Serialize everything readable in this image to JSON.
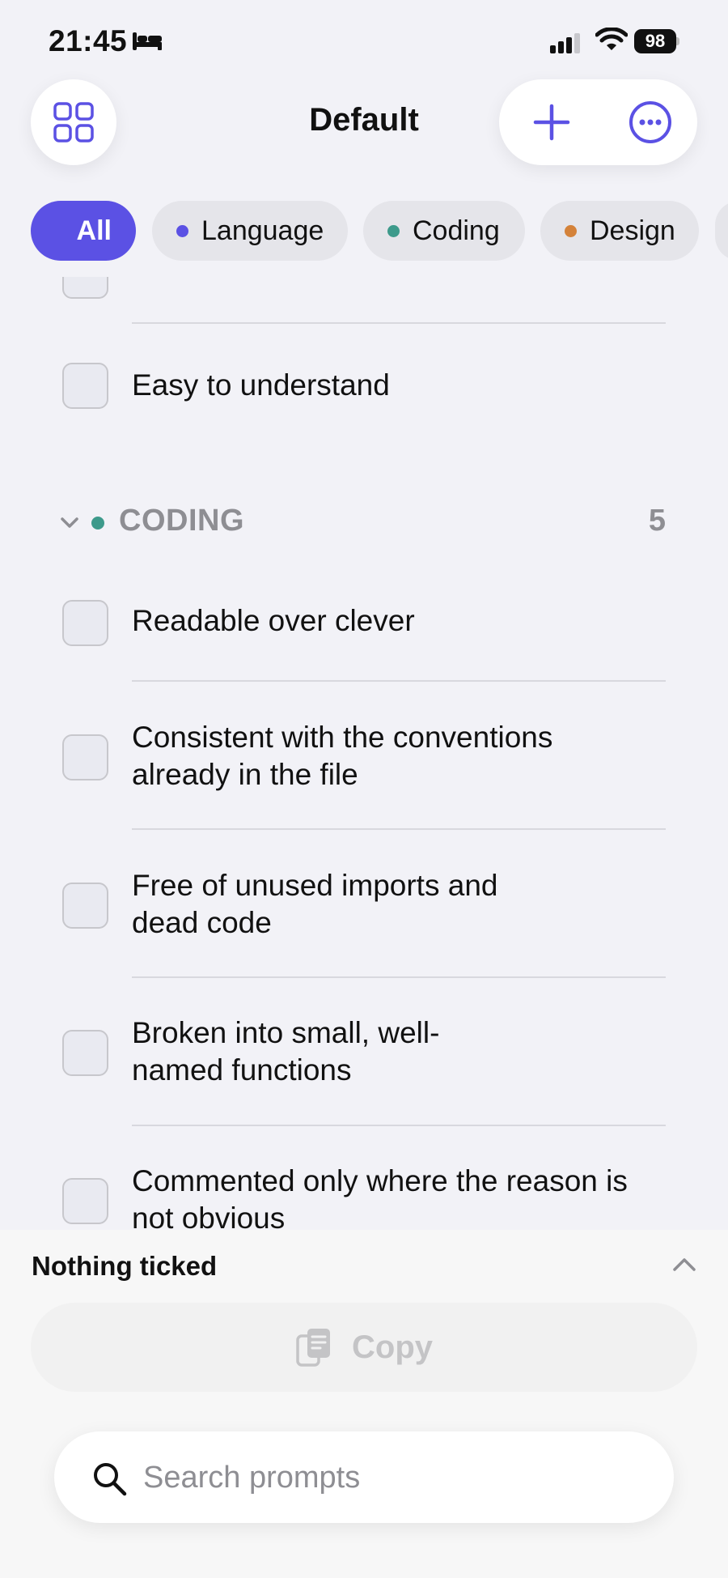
{
  "status_bar": {
    "time": "21:45",
    "battery": "98",
    "icons": [
      "bed-icon",
      "signal-icon",
      "wifi-icon",
      "battery-icon"
    ]
  },
  "header": {
    "title": "Default",
    "left_icon": "grid-icon",
    "right_icons": [
      "plus-icon",
      "more-icon"
    ]
  },
  "filters": [
    {
      "label": "All",
      "active": true
    },
    {
      "label": "Language",
      "dot_color": "#5b51e4"
    },
    {
      "label": "Coding",
      "dot_color": "#3d9a8b"
    },
    {
      "label": "Design",
      "dot_color": "#d4823a"
    }
  ],
  "list": {
    "previous_section_last_item": "Easy to understand",
    "section": {
      "title": "CODING",
      "count": "5",
      "dot_color": "#3d9a8b",
      "items": [
        "Readable over clever",
        "Consistent with the conventions already in the file",
        "Free of unused imports and dead code",
        "Broken into small, well-named functions",
        "Commented only where the reason is not obvious"
      ]
    }
  },
  "bottom": {
    "status": "Nothing ticked",
    "copy_label": "Copy",
    "search_placeholder": "Search prompts"
  },
  "colors": {
    "accent": "#5b51e4",
    "background": "#f2f2f7"
  }
}
